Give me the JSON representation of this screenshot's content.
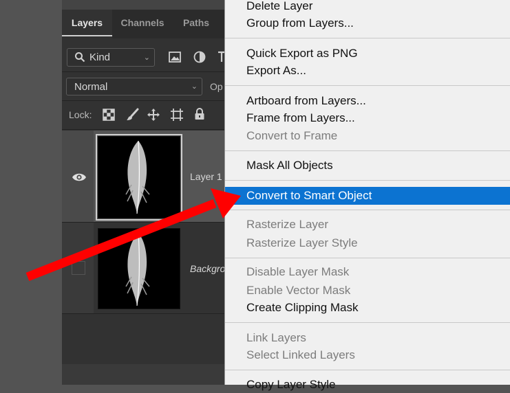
{
  "layers_panel": {
    "tabs": [
      "Layers",
      "Channels",
      "Paths"
    ],
    "active_tab": "Layers",
    "filter": {
      "label": "Kind"
    },
    "blend_mode": "Normal",
    "opacity_label_partial": "Op",
    "lock_label": "Lock:",
    "layers": [
      {
        "name": "Layer 1",
        "visible": true,
        "selected": true
      },
      {
        "name": "Backgro",
        "visible": false,
        "selected": false
      }
    ]
  },
  "context_menu": {
    "items": [
      {
        "label": "Delete Layer",
        "enabled": true
      },
      {
        "label": "Group from Layers...",
        "enabled": true
      },
      {
        "label": "Quick Export as PNG",
        "enabled": true
      },
      {
        "label": "Export As...",
        "enabled": true
      },
      {
        "label": "Artboard from Layers...",
        "enabled": true
      },
      {
        "label": "Frame from Layers...",
        "enabled": true
      },
      {
        "label": "Convert to Frame",
        "enabled": false
      },
      {
        "label": "Mask All Objects",
        "enabled": true
      },
      {
        "label": "Convert to Smart Object",
        "enabled": true,
        "highlighted": true
      },
      {
        "label": "Rasterize Layer",
        "enabled": false
      },
      {
        "label": "Rasterize Layer Style",
        "enabled": false
      },
      {
        "label": "Disable Layer Mask",
        "enabled": false
      },
      {
        "label": "Enable Vector Mask",
        "enabled": false
      },
      {
        "label": "Create Clipping Mask",
        "enabled": true
      },
      {
        "label": "Link Layers",
        "enabled": false
      },
      {
        "label": "Select Linked Layers",
        "enabled": false
      },
      {
        "label": "Copy Layer Style",
        "enabled": true
      }
    ],
    "highlight_color": "#0c73d1"
  },
  "annotation": {
    "arrow_color": "#ff0000"
  }
}
